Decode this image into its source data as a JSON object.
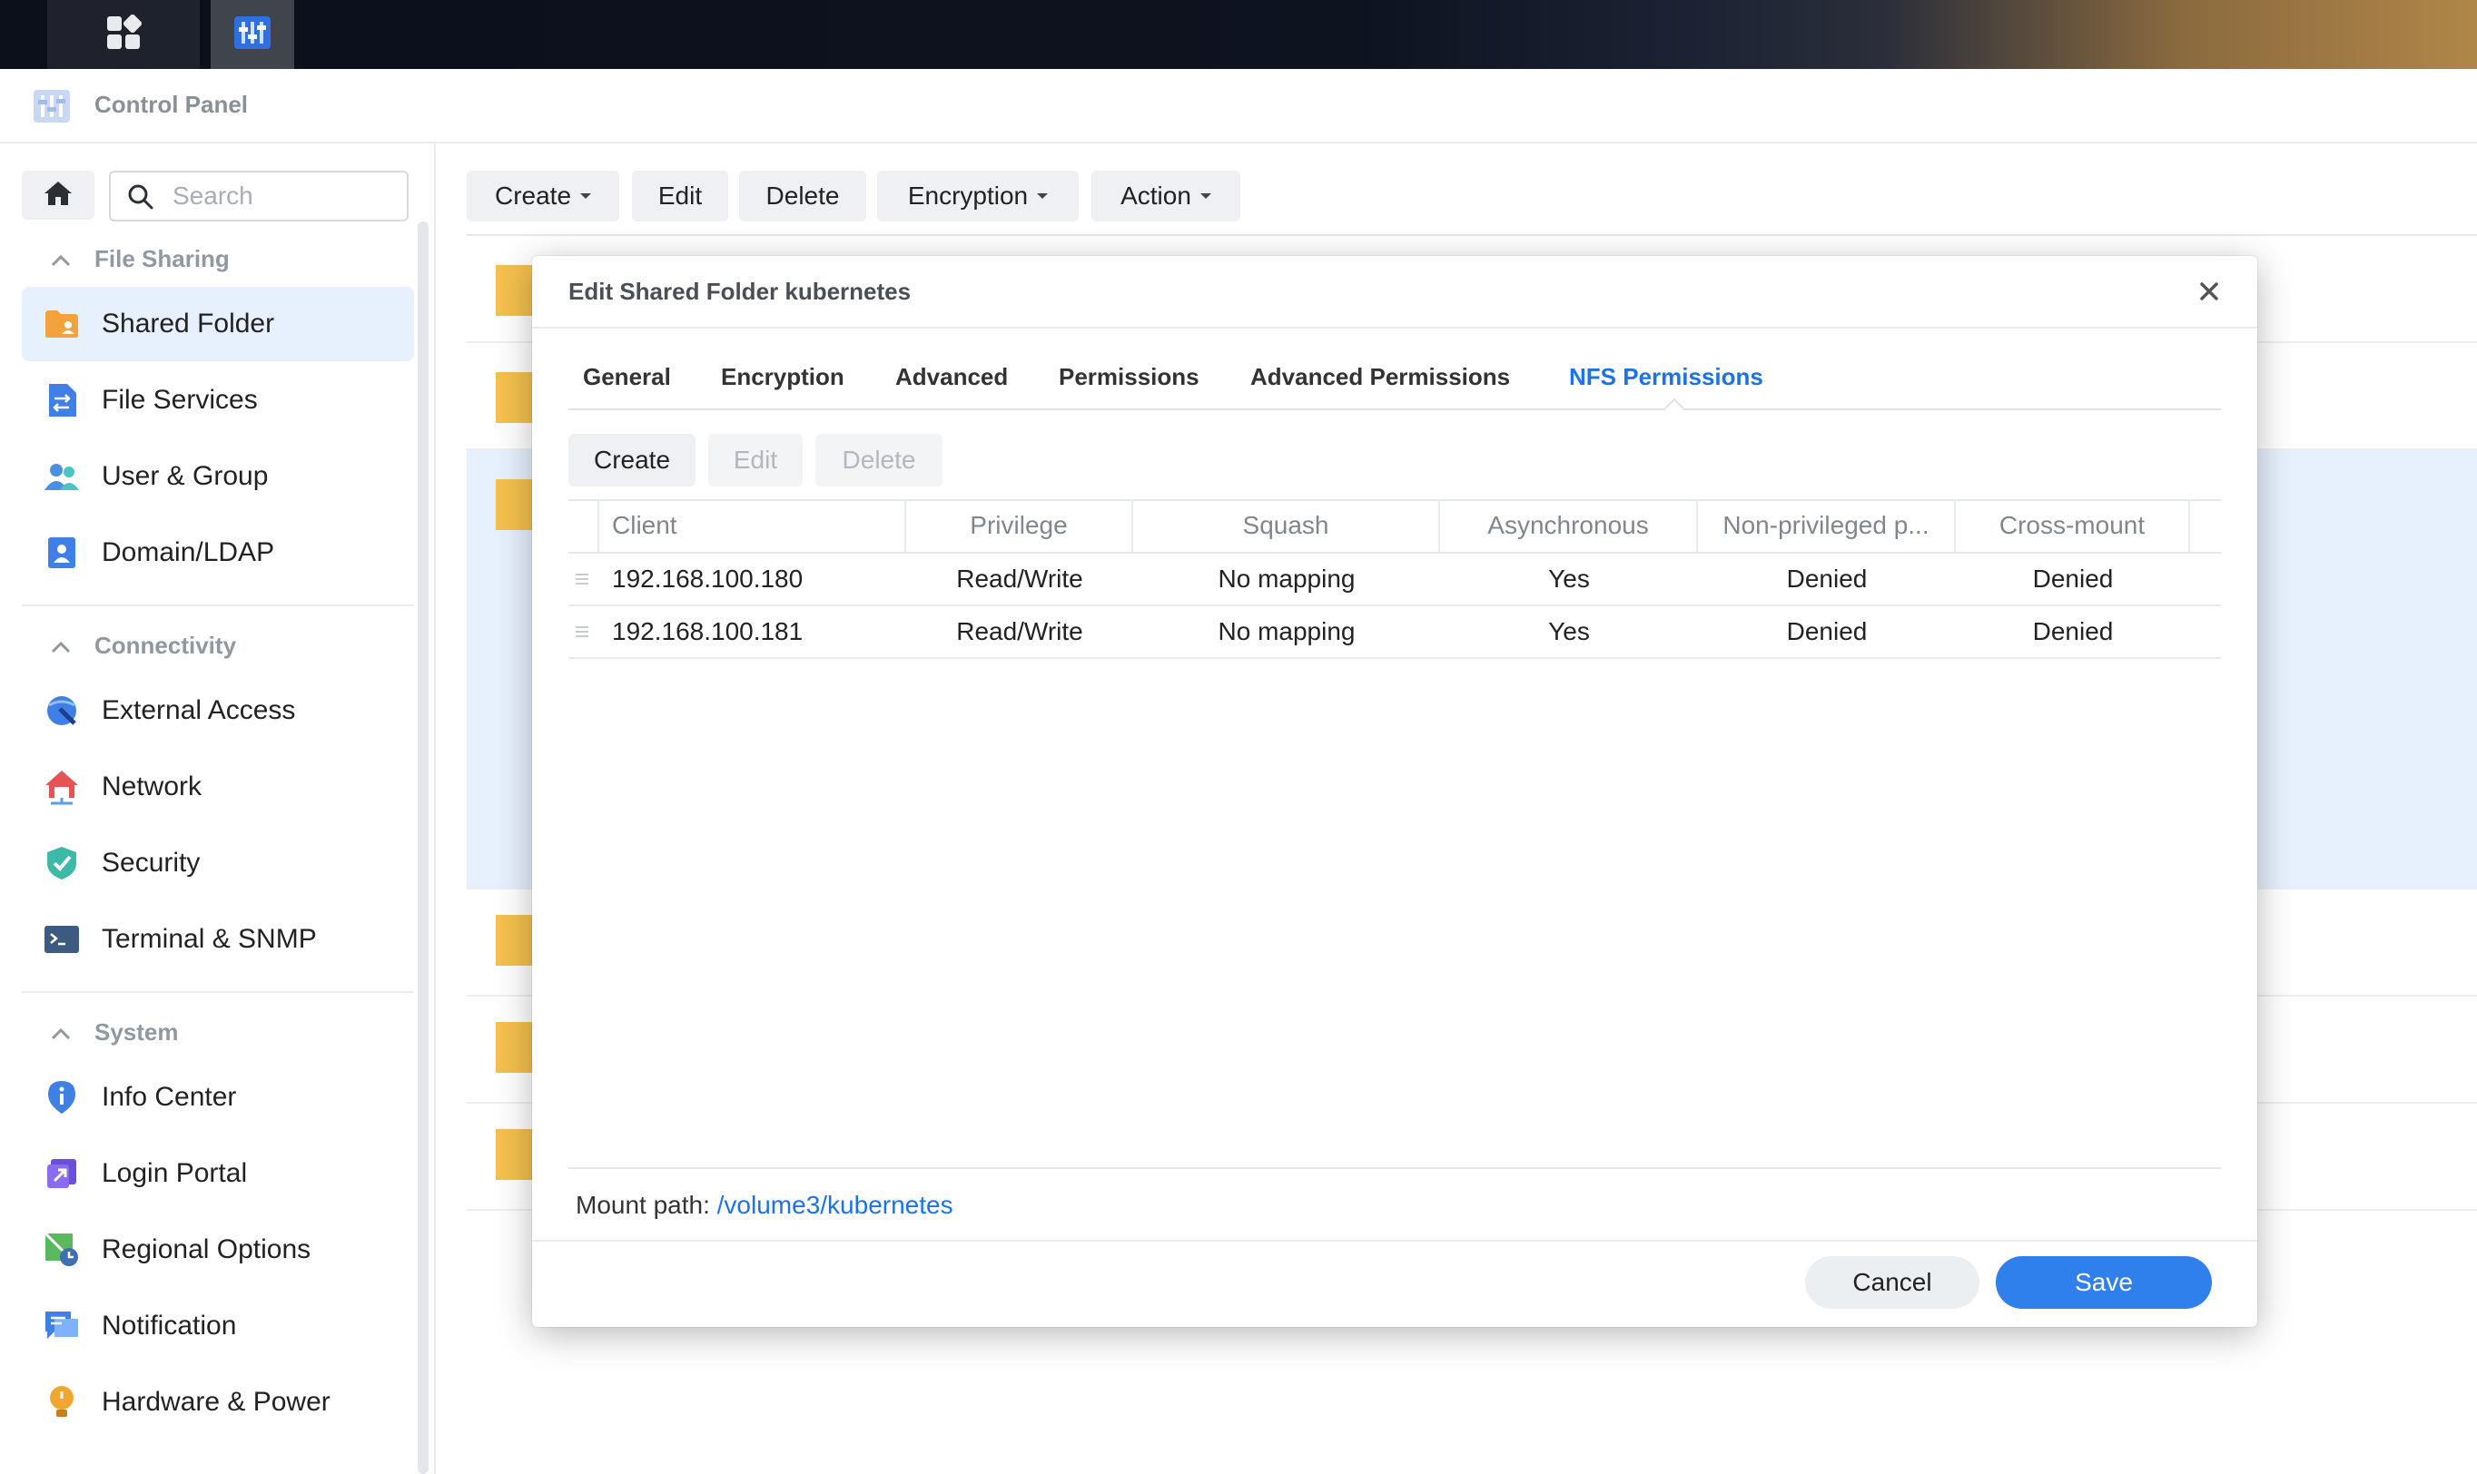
{
  "window": {
    "title": "Control Panel"
  },
  "search": {
    "placeholder": "Search",
    "value": ""
  },
  "sidebar": {
    "sections": [
      {
        "title": "File Sharing",
        "items": [
          {
            "label": "Shared Folder",
            "icon": "shared-folder-icon",
            "active": true
          },
          {
            "label": "File Services",
            "icon": "file-services-icon"
          },
          {
            "label": "User & Group",
            "icon": "user-group-icon"
          },
          {
            "label": "Domain/LDAP",
            "icon": "domain-ldap-icon"
          }
        ]
      },
      {
        "title": "Connectivity",
        "items": [
          {
            "label": "External Access",
            "icon": "external-access-icon"
          },
          {
            "label": "Network",
            "icon": "network-icon"
          },
          {
            "label": "Security",
            "icon": "security-shield-icon"
          },
          {
            "label": "Terminal & SNMP",
            "icon": "terminal-icon"
          }
        ]
      },
      {
        "title": "System",
        "items": [
          {
            "label": "Info Center",
            "icon": "info-center-icon"
          },
          {
            "label": "Login Portal",
            "icon": "login-portal-icon"
          },
          {
            "label": "Regional Options",
            "icon": "regional-options-icon"
          },
          {
            "label": "Notification",
            "icon": "notification-icon"
          },
          {
            "label": "Hardware & Power",
            "icon": "hardware-power-icon"
          }
        ]
      }
    ]
  },
  "toolbar": {
    "create": "Create",
    "edit": "Edit",
    "delete": "Delete",
    "encryption": "Encryption",
    "action": "Action"
  },
  "dialog": {
    "title": "Edit Shared Folder kubernetes",
    "tabs": [
      "General",
      "Encryption",
      "Advanced",
      "Permissions",
      "Advanced Permissions",
      "NFS Permissions"
    ],
    "active_tab": "NFS Permissions",
    "buttons": {
      "create": "Create",
      "edit": "Edit",
      "delete": "Delete"
    },
    "columns": [
      "Client",
      "Privilege",
      "Squash",
      "Asynchronous",
      "Non-privileged p...",
      "Cross-mount"
    ],
    "rows": [
      {
        "client": "192.168.100.180",
        "privilege": "Read/Write",
        "squash": "No mapping",
        "async": "Yes",
        "nonpriv": "Denied",
        "crossmount": "Denied"
      },
      {
        "client": "192.168.100.181",
        "privilege": "Read/Write",
        "squash": "No mapping",
        "async": "Yes",
        "nonpriv": "Denied",
        "crossmount": "Denied"
      }
    ],
    "mount_label": "Mount path:",
    "mount_path": "/volume3/kubernetes",
    "cancel": "Cancel",
    "save": "Save"
  },
  "colors": {
    "accent": "#1a73e8",
    "primary_button": "#2f80ed",
    "selected_bg": "#e7f0fd"
  }
}
